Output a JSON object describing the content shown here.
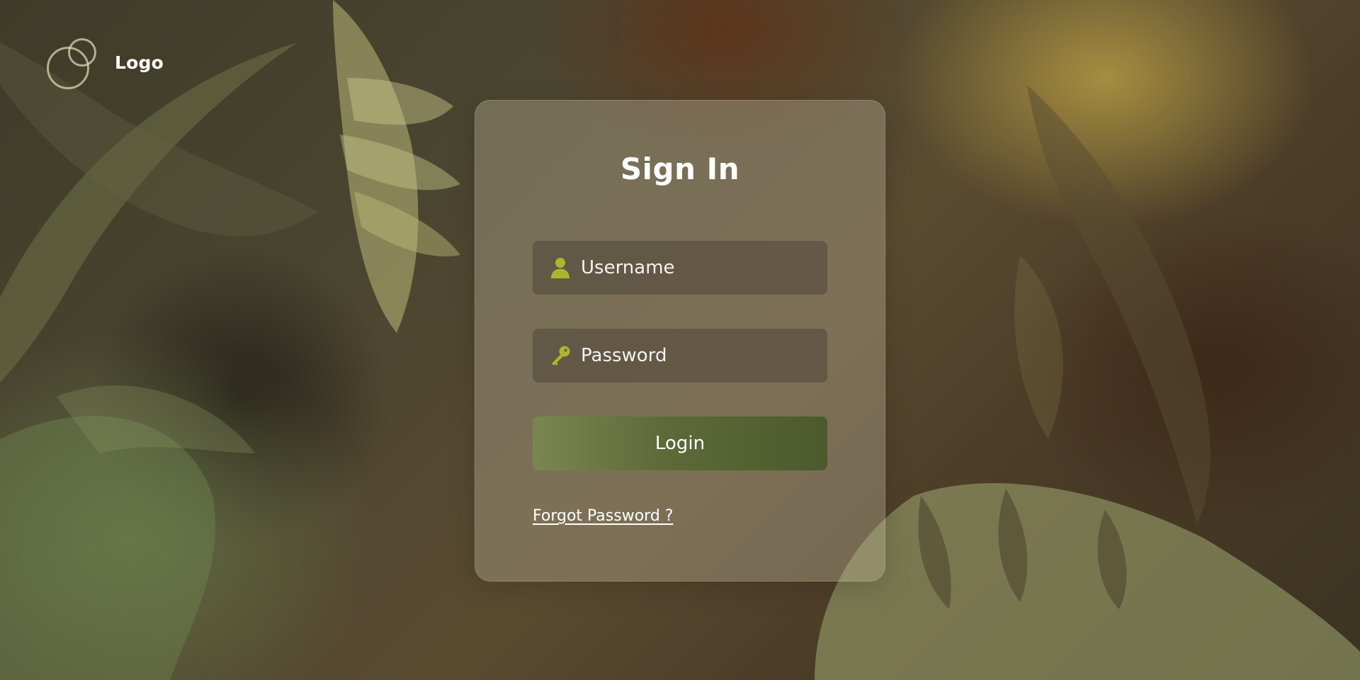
{
  "brand": {
    "name": "Logo",
    "icon": "overlapping-circles-logo"
  },
  "login_card": {
    "title": "Sign In",
    "username": {
      "placeholder": "Username",
      "value": "",
      "icon": "user-icon"
    },
    "password": {
      "placeholder": "Password",
      "value": "",
      "icon": "key-icon"
    },
    "login_label": "Login",
    "forgot_label": "Forgot Password ?"
  },
  "colors": {
    "accent": "#a9b82a",
    "button": "#5d6a38",
    "text": "#ffffff"
  }
}
